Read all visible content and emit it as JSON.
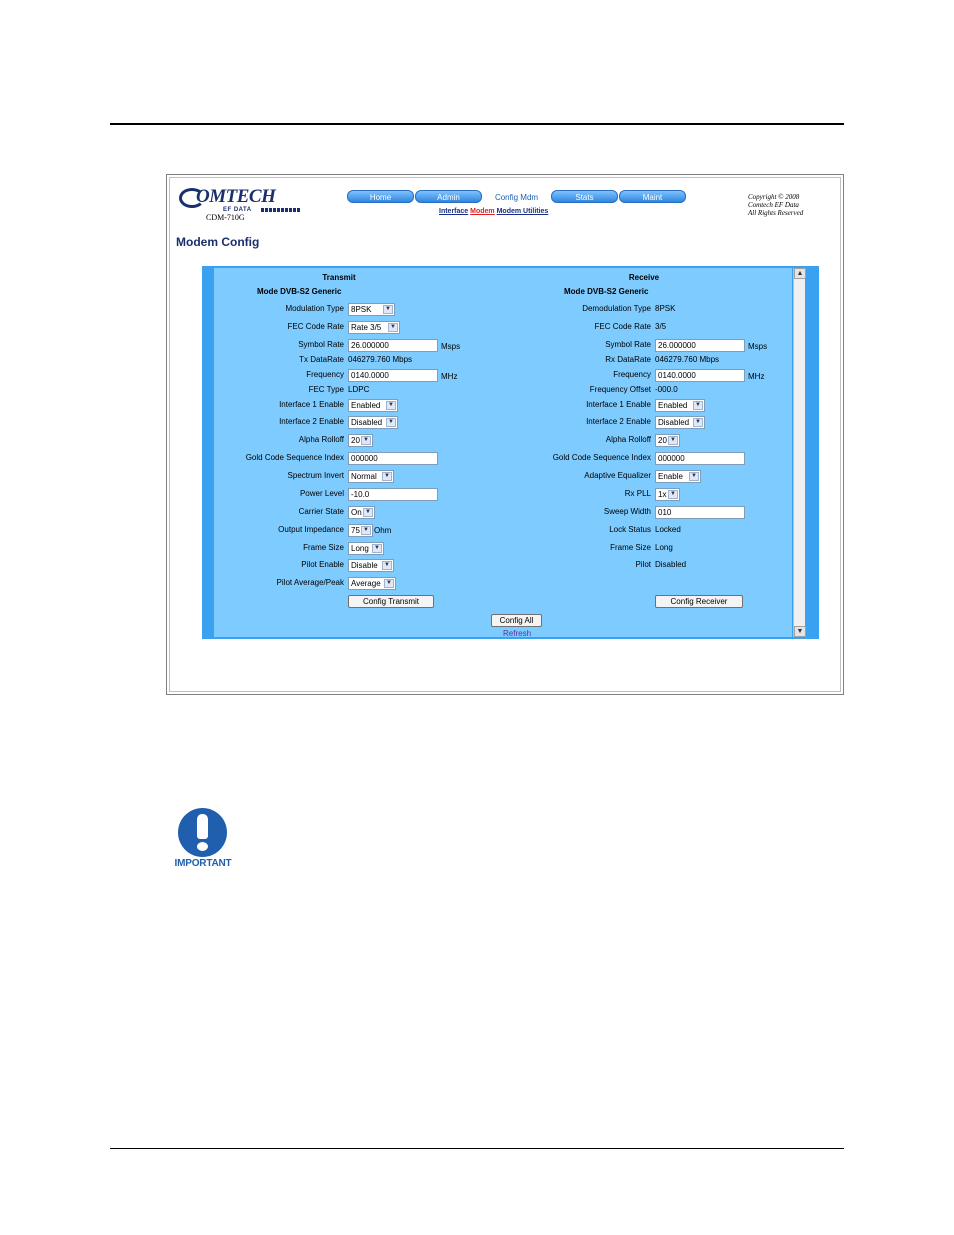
{
  "header": {
    "logo_text": "OMTECH",
    "logo_sub": "EF DATA",
    "model": "CDM-710G",
    "nav_tabs": [
      "Home",
      "Admin",
      "Config Mdm",
      "Stats",
      "Maint"
    ],
    "sub_links": [
      "Interface",
      "Modem",
      "Modem Utilities"
    ],
    "copyright": [
      "Copyright © 2008",
      "Comtech EF Data",
      "All Rights Reserved"
    ]
  },
  "page_title": "Modem Config",
  "transmit": {
    "heading": "Transmit",
    "mode": "Mode DVB-S2 Generic",
    "modulation_type": {
      "label": "Modulation Type",
      "value": "8PSK"
    },
    "fec_code_rate": {
      "label": "FEC Code Rate",
      "value": "Rate 3/5"
    },
    "symbol_rate": {
      "label": "Symbol Rate",
      "value": "26.000000",
      "unit": "Msps"
    },
    "tx_datarate": {
      "label": "Tx DataRate",
      "value": "046279.760  Mbps"
    },
    "frequency": {
      "label": "Frequency",
      "value": "0140.0000",
      "unit": "MHz"
    },
    "fec_type": {
      "label": "FEC Type",
      "value": "LDPC"
    },
    "interface1": {
      "label": "Interface 1 Enable",
      "value": "Enabled"
    },
    "interface2": {
      "label": "Interface 2 Enable",
      "value": "Disabled"
    },
    "alpha_rolloff": {
      "label": "Alpha Rolloff",
      "value": "20"
    },
    "gold_code": {
      "label": "Gold Code Sequence Index",
      "value": "000000"
    },
    "spectrum_invert": {
      "label": "Spectrum Invert",
      "value": "Normal"
    },
    "power_level": {
      "label": "Power Level",
      "value": "-10.0"
    },
    "carrier_state": {
      "label": "Carrier State",
      "value": "On"
    },
    "output_impedance": {
      "label": "Output Impedance",
      "value": "75",
      "unit": "Ohm"
    },
    "frame_size": {
      "label": "Frame Size",
      "value": "Long"
    },
    "pilot_enable": {
      "label": "Pilot Enable",
      "value": "Disable"
    },
    "pilot_avg_peak": {
      "label": "Pilot Average/Peak",
      "value": "Average"
    },
    "config_button": "Config Transmit"
  },
  "receive": {
    "heading": "Receive",
    "mode": "Mode DVB-S2 Generic",
    "demodulation_type": {
      "label": "Demodulation Type",
      "value": "8PSK"
    },
    "fec_code_rate": {
      "label": "FEC Code Rate",
      "value": "3/5"
    },
    "symbol_rate": {
      "label": "Symbol Rate",
      "value": "26.000000",
      "unit": "Msps"
    },
    "rx_datarate": {
      "label": "Rx DataRate",
      "value": "046279.760  Mbps"
    },
    "frequency": {
      "label": "Frequency",
      "value": "0140.0000",
      "unit": "MHz"
    },
    "frequency_offset": {
      "label": "Frequency Offset",
      "value": "-000.0"
    },
    "interface1": {
      "label": "Interface 1 Enable",
      "value": "Enabled"
    },
    "interface2": {
      "label": "Interface 2 Enable",
      "value": "Disabled"
    },
    "alpha_rolloff": {
      "label": "Alpha Rolloff",
      "value": "20"
    },
    "gold_code": {
      "label": "Gold Code Sequence Index",
      "value": "000000"
    },
    "adaptive_equalizer": {
      "label": "Adaptive Equalizer",
      "value": "Enable"
    },
    "rx_pll": {
      "label": "Rx PLL",
      "value": "1x"
    },
    "sweep_width": {
      "label": "Sweep Width",
      "value": "010"
    },
    "lock_status": {
      "label": "Lock Status",
      "value": "Locked"
    },
    "frame_size": {
      "label": "Frame Size",
      "value": "Long"
    },
    "pilot": {
      "label": "Pilot",
      "value": "Disabled"
    },
    "config_button": "Config Receiver"
  },
  "config_all_button": "Config All",
  "refresh_link": "Refresh",
  "important_label": "IMPORTANT",
  "icons": {
    "scroll_up": "▲",
    "scroll_down": "▼",
    "dropdown": "▼"
  }
}
